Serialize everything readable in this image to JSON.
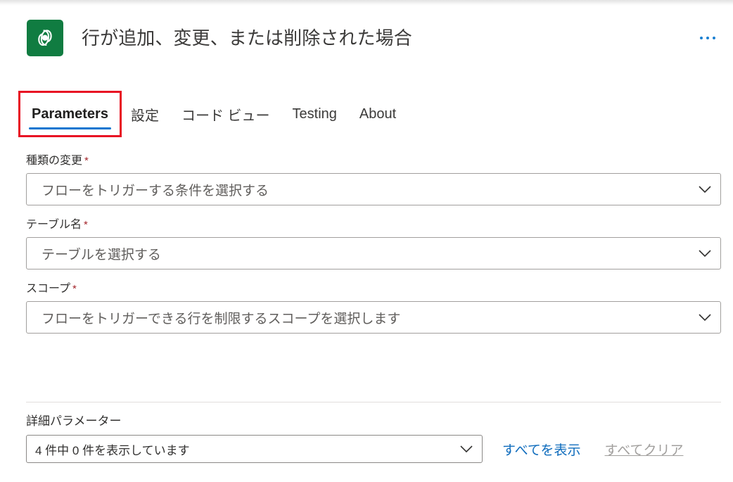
{
  "header": {
    "icon_name": "dataverse-icon",
    "icon_color": "#107c41",
    "title": "行が追加、変更、または削除された場合",
    "overflow_label": "···"
  },
  "tabs": [
    {
      "label": "Parameters",
      "selected": true,
      "highlighted": true
    },
    {
      "label": "設定",
      "selected": false,
      "highlighted": false
    },
    {
      "label": "コード ビュー",
      "selected": false,
      "highlighted": false
    },
    {
      "label": "Testing",
      "selected": false,
      "highlighted": false
    },
    {
      "label": "About",
      "selected": false,
      "highlighted": false
    }
  ],
  "fields": [
    {
      "label": "種類の変更",
      "required": true,
      "required_marker": "*",
      "placeholder": "フローをトリガーする条件を選択する",
      "chevron": "chevron-down-icon"
    },
    {
      "label": "テーブル名",
      "required": true,
      "required_marker": "*",
      "placeholder": "テーブルを選択する",
      "chevron": "chevron-down-icon"
    },
    {
      "label": "スコープ",
      "required": true,
      "required_marker": "*",
      "placeholder": "フローをトリガーできる行を制限するスコープを選択します",
      "chevron": "chevron-down-icon"
    }
  ],
  "advanced": {
    "label": "詳細パラメーター",
    "selector_value": "4 件中 0 件を表示しています",
    "show_all_label": "すべてを表示",
    "clear_all_label": "すべてクリア"
  },
  "colors": {
    "accent": "#0f6cbd",
    "tab_underline": "#0f76d0",
    "highlight_outline": "#e81123",
    "required_star": "#a4262c",
    "brand_green": "#107c41",
    "disabled_text": "#a19f9d"
  }
}
